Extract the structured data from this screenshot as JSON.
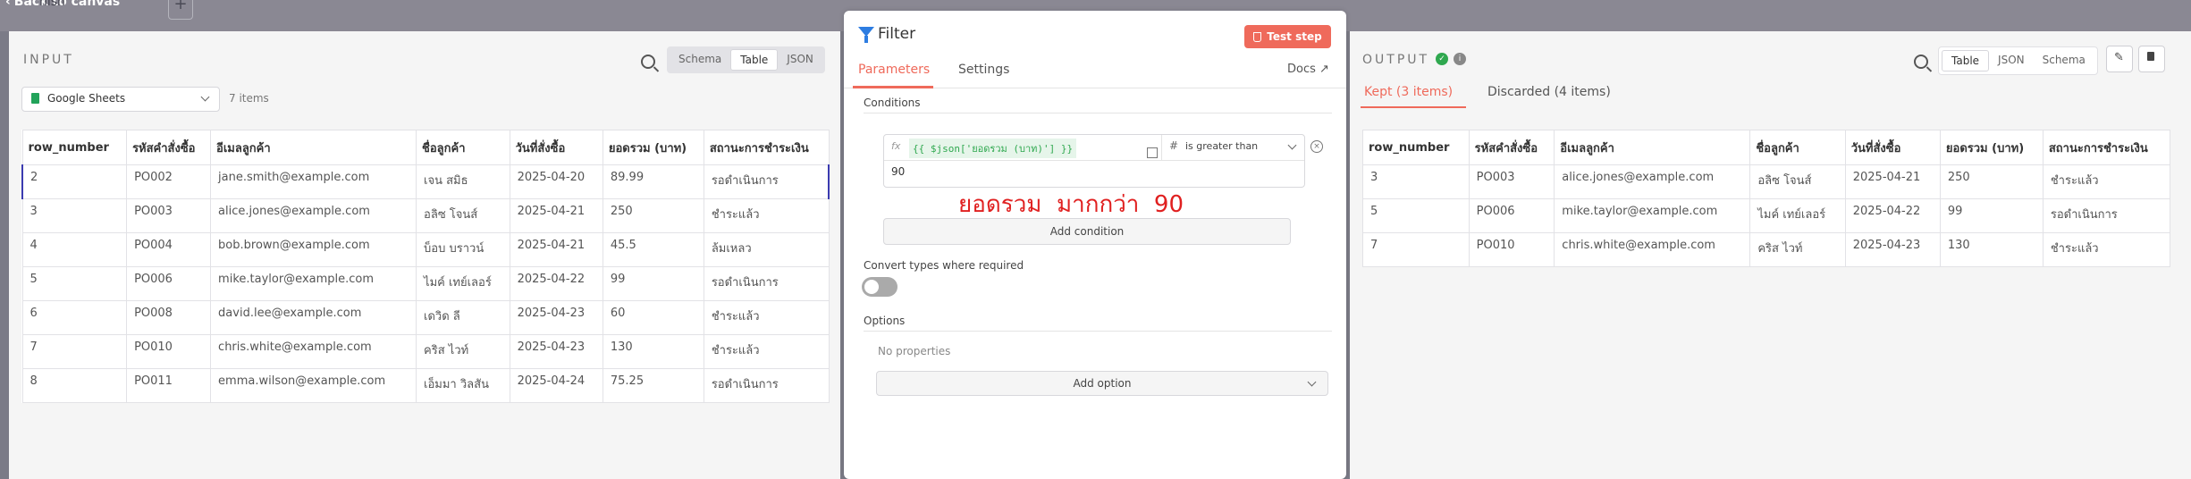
{
  "topbar": {
    "back_label": "Back to canvas",
    "behind_text": "nish",
    "add_icon": "+"
  },
  "input": {
    "title": "INPUT",
    "views": [
      "Schema",
      "Table",
      "JSON"
    ],
    "active_view": "Table",
    "source": "Google Sheets",
    "count": "7 items",
    "columns": [
      "row_number",
      "รหัสคำสั่งซื้อ",
      "อีเมลลูกค้า",
      "ชื่อลูกค้า",
      "วันที่สั่งซื้อ",
      "ยอดรวม (บาท)",
      "สถานะการชำระเงิน"
    ],
    "rows": [
      [
        "2",
        "PO002",
        "jane.smith@example.com",
        "เจน สมิธ",
        "2025-04-20",
        "89.99",
        "รอดำเนินการ"
      ],
      [
        "3",
        "PO003",
        "alice.jones@example.com",
        "อลิซ โจนส์",
        "2025-04-21",
        "250",
        "ชำระแล้ว"
      ],
      [
        "4",
        "PO004",
        "bob.brown@example.com",
        "บ็อบ บราวน์",
        "2025-04-21",
        "45.5",
        "ล้มเหลว"
      ],
      [
        "5",
        "PO006",
        "mike.taylor@example.com",
        "ไมค์ เทย์เลอร์",
        "2025-04-22",
        "99",
        "รอดำเนินการ"
      ],
      [
        "6",
        "PO008",
        "david.lee@example.com",
        "เดวิด ลี",
        "2025-04-23",
        "60",
        "ชำระแล้ว"
      ],
      [
        "7",
        "PO010",
        "chris.white@example.com",
        "คริส ไวท์",
        "2025-04-23",
        "130",
        "ชำระแล้ว"
      ],
      [
        "8",
        "PO011",
        "emma.wilson@example.com",
        "เอ็มมา วิลสัน",
        "2025-04-24",
        "75.25",
        "รอดำเนินการ"
      ]
    ]
  },
  "filter": {
    "title": "Filter",
    "test_button": "Test step",
    "tabs": [
      "Parameters",
      "Settings"
    ],
    "docs": "Docs",
    "conditions_label": "Conditions",
    "expression": "{{ $json['ยอดรวม (บาท)'] }}",
    "fx": "fx",
    "operator": "is greater than",
    "value": "90",
    "annotation": "ยอดรวม  มากกว่า  90",
    "add_condition": "Add condition",
    "convert_label": "Convert types where required",
    "options_label": "Options",
    "no_properties": "No properties",
    "add_option": "Add option"
  },
  "output": {
    "title": "OUTPUT",
    "views": [
      "Table",
      "JSON",
      "Schema"
    ],
    "active_view": "Table",
    "tabs": [
      "Kept (3 items)",
      "Discarded (4 items)"
    ],
    "columns": [
      "row_number",
      "รหัสคำสั่งซื้อ",
      "อีเมลลูกค้า",
      "ชื่อลูกค้า",
      "วันที่สั่งซื้อ",
      "ยอดรวม (บาท)",
      "สถานะการชำระเงิน"
    ],
    "rows": [
      [
        "3",
        "PO003",
        "alice.jones@example.com",
        "อลิซ โจนส์",
        "2025-04-21",
        "250",
        "ชำระแล้ว"
      ],
      [
        "5",
        "PO006",
        "mike.taylor@example.com",
        "ไมค์ เทย์เลอร์",
        "2025-04-22",
        "99",
        "รอดำเนินการ"
      ],
      [
        "7",
        "PO010",
        "chris.white@example.com",
        "คริส ไวท์",
        "2025-04-23",
        "130",
        "ชำระแล้ว"
      ]
    ]
  },
  "colors": {
    "accent": "#ef6a5b",
    "success": "#2fa84f",
    "filter_icon": "#2e7de1",
    "selected_row": "#3b3bb0",
    "annotation": "#e02020"
  }
}
